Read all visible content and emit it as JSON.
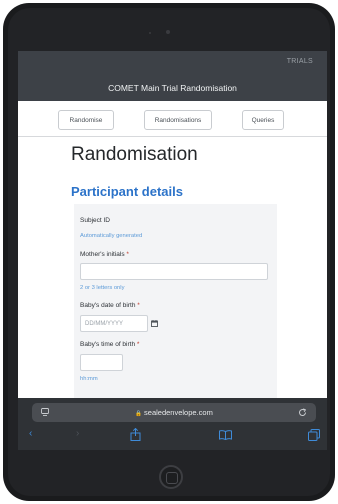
{
  "header": {
    "brand": "TRIALS",
    "title": "COMET Main Trial Randomisation"
  },
  "tabs": [
    {
      "label": "Randomise"
    },
    {
      "label": "Randomisations"
    },
    {
      "label": "Queries"
    }
  ],
  "page": {
    "title": "Randomisation",
    "section": "Participant details"
  },
  "form": {
    "subject_id_label": "Subject ID",
    "subject_id_value": "Automatically generated",
    "mother_initials_label": "Mother's initials",
    "mother_initials_help": "2 or 3 letters only",
    "dob_label": "Baby's date of birth",
    "dob_placeholder": "DD/MM/YYYY",
    "tob_label": "Baby's time of birth",
    "tob_help": "hh:mm",
    "required_marker": "*"
  },
  "browser": {
    "url": "sealedenvelope.com"
  },
  "icons": [
    "camera-icon",
    "reader-icon",
    "lock-icon",
    "reload-icon",
    "back-icon",
    "forward-icon",
    "share-icon",
    "bookmarks-icon",
    "tabs-icon",
    "calendar-icon",
    "home-button-icon"
  ],
  "colors": {
    "accent": "#2c73c9",
    "header": "#3d4147",
    "required": "#c0392b",
    "help_text": "#5d9bd8"
  }
}
